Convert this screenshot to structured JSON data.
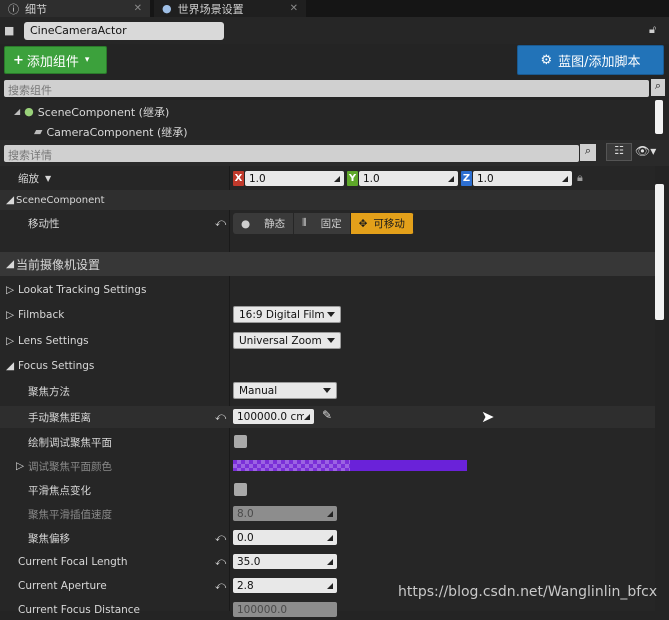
{
  "tabs": [
    {
      "label": "细节",
      "icon": "details-icon"
    },
    {
      "label": "世界场景设置",
      "icon": "globe-icon"
    }
  ],
  "actor": {
    "name": "CineCameraActor"
  },
  "toolbar": {
    "add_component": "添加组件",
    "blueprint_script": "蓝图/添加脚本"
  },
  "component_search": {
    "placeholder": "搜索组件"
  },
  "components": [
    {
      "label": "SceneComponent (继承)"
    },
    {
      "label": "CameraComponent (继承)"
    }
  ],
  "details_search": {
    "placeholder": "搜索详情"
  },
  "transform": {
    "scale_label": "缩放",
    "x_label": "X",
    "x": "1.0",
    "y_label": "Y",
    "y": "1.0",
    "z_label": "Z",
    "z": "1.0"
  },
  "scene_component_section": "SceneComponent",
  "mobility": {
    "label": "移动性",
    "options": [
      "静态",
      "固定",
      "可移动"
    ],
    "selected": "可移动"
  },
  "camera_settings": {
    "header": "当前摄像机设置",
    "lookat": "Lookat Tracking Settings",
    "filmback": "Filmback",
    "filmback_value": "16:9 Digital Film",
    "lens": "Lens Settings",
    "lens_value": "Universal Zoom",
    "focus": "Focus Settings",
    "focus_method_label": "聚焦方法",
    "focus_method_value": "Manual",
    "manual_focus_label": "手动聚焦距离",
    "manual_focus_value": "100000.0 cm",
    "draw_debug_plane_label": "绘制调试聚焦平面",
    "debug_plane_color_label": "调试聚焦平面颜色",
    "smooth_focus_label": "平滑焦点变化",
    "smooth_speed_label": "聚焦平滑插值速度",
    "smooth_speed_value": "8.0",
    "focus_offset_label": "聚焦偏移",
    "focus_offset_value": "0.0",
    "current_focal_length_label": "Current Focal Length",
    "current_focal_length_value": "35.0",
    "current_aperture_label": "Current Aperture",
    "current_aperture_value": "2.8",
    "current_focus_distance_label": "Current Focus Distance",
    "current_focus_distance_value": "100000.0"
  },
  "watermark": "https://blog.csdn.net/Wanglinlin_bfcx",
  "colors": {
    "add_button": "#3ca13c",
    "blueprint_button": "#2273b8",
    "mobility_selected": "#e3a01a",
    "debug_plane_color": "#6a22d9",
    "x_axis": "#c0392b",
    "y_axis": "#5fa82a",
    "z_axis": "#2d6fd1"
  }
}
